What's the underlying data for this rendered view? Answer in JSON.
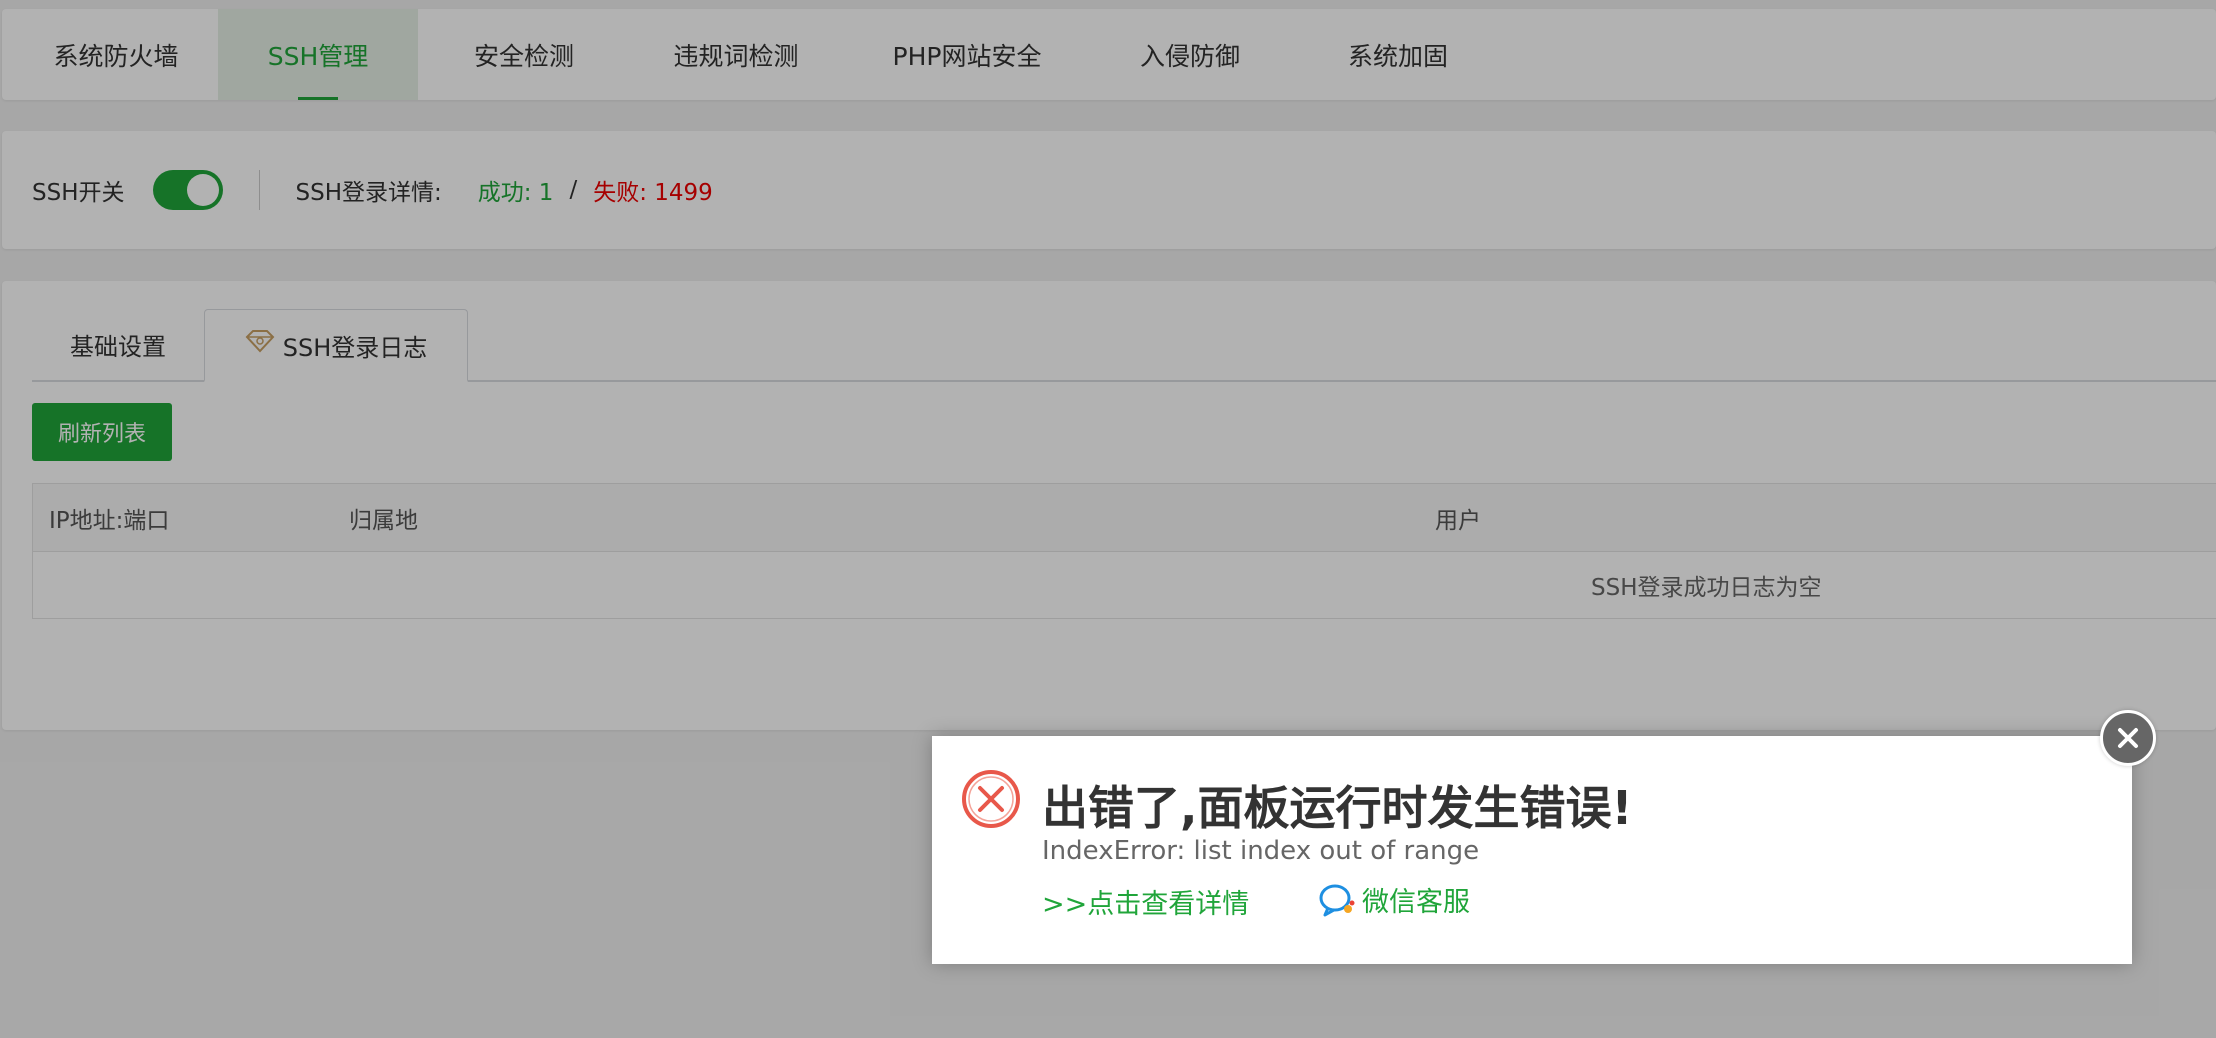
{
  "colors": {
    "accent": "#20a53a",
    "danger": "#e00000"
  },
  "top_nav": {
    "items": [
      {
        "label": "系统防火墙",
        "active": false
      },
      {
        "label": "SSH管理",
        "active": true
      },
      {
        "label": "安全检测",
        "active": false
      },
      {
        "label": "违规词检测",
        "active": false
      },
      {
        "label": "PHP网站安全",
        "active": false
      },
      {
        "label": "入侵防御",
        "active": false
      },
      {
        "label": "系统加固",
        "active": false
      }
    ]
  },
  "ssh_status": {
    "switch_label": "SSH开关",
    "switch_on": true,
    "login_details_label": "SSH登录详情:",
    "success_text": "成功: 1",
    "separator": "/",
    "fail_text": "失败: 1499"
  },
  "sub_tabs": {
    "basic_label": "基础设置",
    "log_label": "SSH登录日志",
    "log_icon": "gem-icon"
  },
  "log_panel": {
    "refresh_label": "刷新列表",
    "columns": [
      "IP地址:端口",
      "归属地",
      "用户"
    ],
    "empty_text": "SSH登录成功日志为空"
  },
  "error_dialog": {
    "title": "出错了,面板运行时发生错误!",
    "message": "IndexError: list index out of range",
    "details_link": ">>点击查看详情",
    "support_link": "微信客服",
    "close_icon": "close-icon"
  }
}
